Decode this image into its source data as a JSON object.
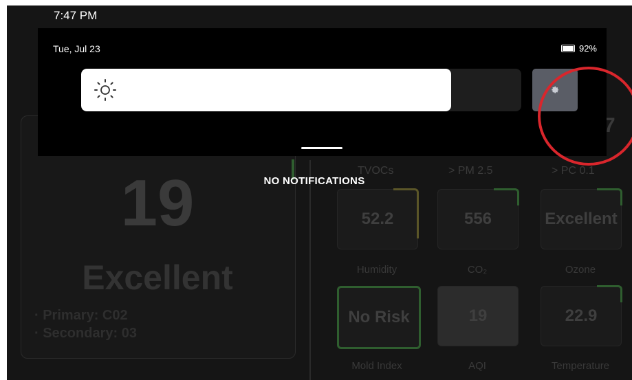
{
  "status_bar": {
    "time": "7:47 PM"
  },
  "quick_settings": {
    "date": "Tue, Jul 23",
    "battery_percent": "92%",
    "brightness_level": 0.84,
    "brightness_icon": "sun-icon",
    "settings_icon": "gear-icon"
  },
  "notifications": {
    "empty_label": "NO NOTIFICATIONS"
  },
  "dashboard": {
    "score": "19",
    "status": "Excellent",
    "primary": "· Primary: C02",
    "secondary": "· Secondary: 03",
    "partial_value": "7",
    "headers": [
      "TVOCs",
      "> PM 2.5",
      "> PC 0.1"
    ],
    "tiles_row1": [
      {
        "value": "52.2",
        "label": "Humidity"
      },
      {
        "value": "556",
        "label": "CO₂"
      },
      {
        "value": "Excellent",
        "label": "Ozone"
      }
    ],
    "tiles_row2": [
      {
        "value": "No Risk",
        "label": "Mold Index"
      },
      {
        "value": "19",
        "label": "AQI"
      },
      {
        "value": "22.9",
        "label": "Temperature"
      }
    ]
  },
  "colors": {
    "highlight": "#d9262c",
    "settings_button": "#5a5d66",
    "accent_green": "#2f5e2f",
    "accent_yellow": "#5b5628"
  }
}
